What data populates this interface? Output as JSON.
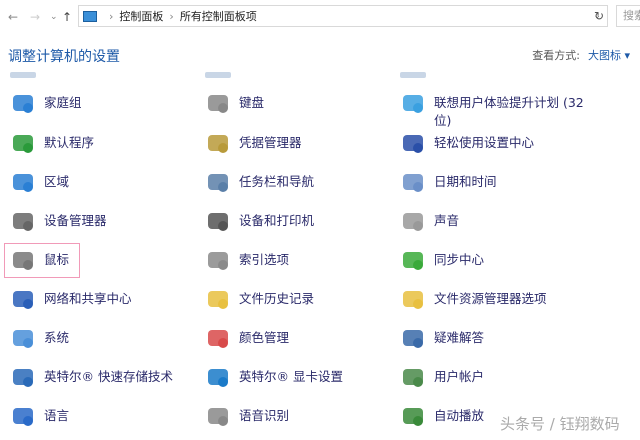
{
  "nav": {
    "back": "←",
    "forward": "→",
    "recent": "⌄",
    "up": "↑"
  },
  "address": {
    "crumbs": [
      "控制面板",
      "所有控制面板项"
    ],
    "sep": "›",
    "dropdown": "⌄"
  },
  "refresh": "↻",
  "search": {
    "placeholder": "搜索"
  },
  "title": "调整计算机的设置",
  "view": {
    "label": "查看方式:",
    "value": "大图标 ▾"
  },
  "items": [
    {
      "label": "家庭组",
      "icon": "homegroup-icon",
      "color": "#2a7fd4"
    },
    {
      "label": "键盘",
      "icon": "keyboard-icon",
      "color": "#888888"
    },
    {
      "label": "联想用户体验提升计划 (32位)",
      "icon": "lenovo-ux-icon",
      "color": "#3aa0e0"
    },
    {
      "label": "默认程序",
      "icon": "default-programs-icon",
      "color": "#2a9a3a"
    },
    {
      "label": "凭据管理器",
      "icon": "credential-manager-icon",
      "color": "#b89a3a"
    },
    {
      "label": "轻松使用设置中心",
      "icon": "ease-of-access-icon",
      "color": "#2a4fa8"
    },
    {
      "label": "区域",
      "icon": "region-icon",
      "color": "#2a7fd4"
    },
    {
      "label": "任务栏和导航",
      "icon": "taskbar-icon",
      "color": "#5a7fa8"
    },
    {
      "label": "日期和时间",
      "icon": "date-time-icon",
      "color": "#6a8fc8"
    },
    {
      "label": "设备管理器",
      "icon": "device-manager-icon",
      "color": "#666666"
    },
    {
      "label": "设备和打印机",
      "icon": "printer-icon",
      "color": "#555555"
    },
    {
      "label": "声音",
      "icon": "sound-icon",
      "color": "#999999"
    },
    {
      "label": "鼠标",
      "icon": "mouse-icon",
      "color": "#777777"
    },
    {
      "label": "索引选项",
      "icon": "indexing-icon",
      "color": "#8a8a8a"
    },
    {
      "label": "同步中心",
      "icon": "sync-icon",
      "color": "#3aaa3a"
    },
    {
      "label": "网络和共享中心",
      "icon": "network-icon",
      "color": "#2a5fb8"
    },
    {
      "label": "文件历史记录",
      "icon": "file-history-icon",
      "color": "#e8c040"
    },
    {
      "label": "文件资源管理器选项",
      "icon": "explorer-options-icon",
      "color": "#e8c040"
    },
    {
      "label": "系统",
      "icon": "system-icon",
      "color": "#4a8fd8"
    },
    {
      "label": "颜色管理",
      "icon": "color-management-icon",
      "color": "#d84a4a"
    },
    {
      "label": "疑难解答",
      "icon": "troubleshooting-icon",
      "color": "#3a6aa8"
    },
    {
      "label": "英特尔® 快速存储技术",
      "icon": "intel-rst-icon",
      "color": "#2a6ab8"
    },
    {
      "label": "英特尔® 显卡设置",
      "icon": "intel-graphics-icon",
      "color": "#1a7ac8"
    },
    {
      "label": "用户帐户",
      "icon": "user-accounts-icon",
      "color": "#4a8a4a"
    },
    {
      "label": "语言",
      "icon": "language-icon",
      "color": "#2a6ac8"
    },
    {
      "label": "语音识别",
      "icon": "speech-recognition-icon",
      "color": "#888888"
    },
    {
      "label": "自动播放",
      "icon": "autoplay-icon",
      "color": "#3a8a3a"
    }
  ],
  "watermark": "头条号 / 钰翔数码"
}
